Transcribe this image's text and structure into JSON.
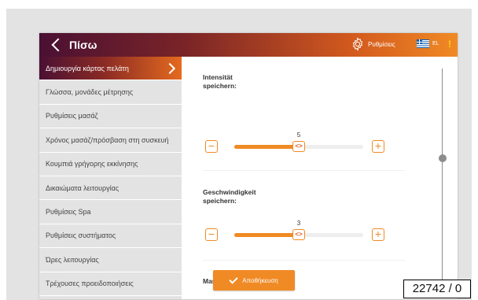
{
  "header": {
    "back_label": "Πίσω",
    "settings_label": "Ρυθμίσεις",
    "language_label": "EL",
    "warning_symbol": "!"
  },
  "sidebar": {
    "items": [
      {
        "label": "Δημιουργία κάρτας πελάτη",
        "active": true
      },
      {
        "label": "Γλώσσα, μονάδες μέτρησης"
      },
      {
        "label": "Ρυθμίσεις μασάζ"
      },
      {
        "label": "Χρόνος μασάζ/πρόσβαση στη συσκευή"
      },
      {
        "label": "Κουμπιά γρήγορης εκκίνησης"
      },
      {
        "label": "Δικαιώματα λειτουργίας"
      },
      {
        "label": "Ρυθμίσεις Spa"
      },
      {
        "label": "Ρυθμίσεις συστήματος"
      },
      {
        "label": "Ώρες λειτουργίας"
      },
      {
        "label": "Τρέχουσες προειδοποιήσεις"
      }
    ]
  },
  "main": {
    "intensity": {
      "title": "Intensität\nspeichern:",
      "value": "5",
      "level": 0.5
    },
    "speed": {
      "title": "Geschwindigkeit\nspeichern:",
      "value": "3",
      "level": 0.5
    },
    "technique_title": "Massagetechnik",
    "thumb_glyph": "<>",
    "minus_glyph": "−",
    "plus_glyph": "+"
  },
  "save_label": "Αποθήκευση",
  "reference_code": "22742 / 0",
  "colors": {
    "accent": "#f08a24",
    "header_dark": "#4a1033",
    "sidebar_bg": "#e3e3e3"
  }
}
